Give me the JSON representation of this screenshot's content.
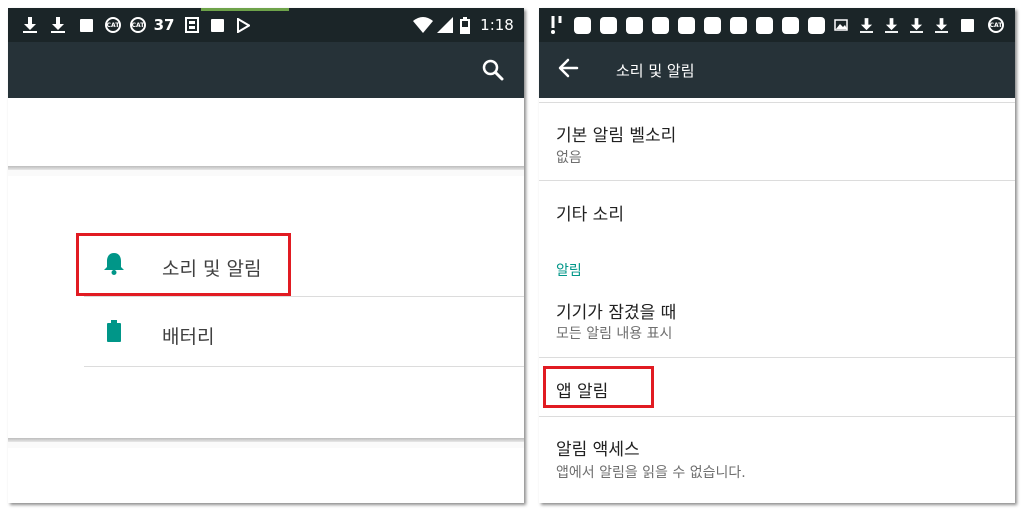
{
  "left_screen": {
    "status_bar": {
      "icons_left": [
        "download-icon",
        "download-icon",
        "square-notification-icon",
        "cat-icon",
        "cat-icon"
      ],
      "badge_number": "37",
      "icons_middle": [
        "image-icon",
        "square-notification-icon",
        "play-store-icon"
      ],
      "icons_right": [
        "wifi-icon",
        "signal-icon",
        "battery-icon"
      ],
      "time": "1:18"
    },
    "app_bar": {
      "action_icon": "search-icon"
    },
    "items": [
      {
        "label": "소리 및 알림",
        "icon": "bell-icon",
        "icon_color": "#009688",
        "highlighted": true
      },
      {
        "label": "배터리",
        "icon": "battery-icon",
        "icon_color": "#009688",
        "highlighted": false
      }
    ]
  },
  "right_screen": {
    "status_bar": {
      "icons": [
        "notification-icon",
        "square-notification-icon",
        "image-icon",
        "download-icon",
        "square-notification-icon",
        "cat-icon"
      ]
    },
    "app_bar": {
      "back_icon": "arrow-left-icon",
      "title": "소리 및 알림"
    },
    "rows": [
      {
        "title": "기본 알림 벨소리",
        "summary": "없음"
      },
      {
        "title": "기타 소리"
      },
      {
        "section": "알림"
      },
      {
        "title": "기기가 잠겼을 때",
        "summary": "모든 알림 내용 표시"
      },
      {
        "title": "앱 알림",
        "highlighted": true
      },
      {
        "title": "알림 액세스",
        "summary": "앱에서 알림을 읽을 수 없습니다."
      }
    ]
  },
  "colors": {
    "status_bar": "#1b2528",
    "app_bar": "#263238",
    "accent": "#009688",
    "highlight": "#e11b22"
  }
}
